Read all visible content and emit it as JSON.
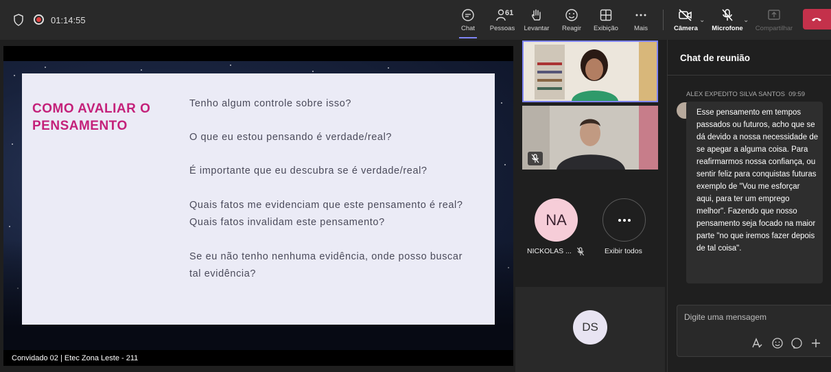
{
  "topbar": {
    "timer": "01:14:55",
    "tools": [
      {
        "label": "Chat",
        "icon": "chat-icon"
      },
      {
        "label": "Pessoas",
        "icon": "people-icon",
        "count": "61"
      },
      {
        "label": "Levantar",
        "icon": "raise-hand-icon"
      },
      {
        "label": "Reagir",
        "icon": "react-icon"
      },
      {
        "label": "Exibição",
        "icon": "view-grid-icon"
      },
      {
        "label": "Mais",
        "icon": "more-icon"
      },
      {
        "label": "Câmera",
        "icon": "camera-off-icon"
      },
      {
        "label": "Microfone",
        "icon": "mic-off-icon"
      },
      {
        "label": "Compartilhar",
        "icon": "share-icon"
      }
    ],
    "leave_color": "#c4314b"
  },
  "slide": {
    "title": "COMO AVALIAR O PENSAMENTO",
    "questions": [
      "Tenho algum controle sobre isso?",
      "O que eu estou pensando é verdade/real?",
      "É importante que eu descubra se é verdade/real?",
      "Quais fatos me evidenciam que este pensamento é real? Quais fatos invalidam este pensamento?",
      "Se eu não tenho nenhuma evidência, onde posso buscar tal evidência?"
    ],
    "title_color": "#c4217a"
  },
  "presenter_caption": "Convidado 02 | Etec Zona Leste - 211",
  "participants": {
    "na_initials": "NA",
    "na_name": "NICKOLAS ...",
    "show_all": "Exibir todos",
    "ds_initials": "DS"
  },
  "chat": {
    "title": "Chat de reunião",
    "sender": "ALEX EXPEDITO SILVA SANTOS",
    "time": "09:59",
    "message": "Esse pensamento em tempos passados ou futuros, acho que se dá devido a nossa necessidade de se apegar a alguma coisa. Para reafirmarmos nossa confiança, ou sentir feliz para conquistas futuras exemplo de \"Vou me esforçar aqui, para ter um emprego melhor\". Fazendo que nosso pensamento seja focado na maior parte \"no que iremos fazer depois de tal coisa\".",
    "compose_placeholder": "Digite uma mensagem"
  }
}
